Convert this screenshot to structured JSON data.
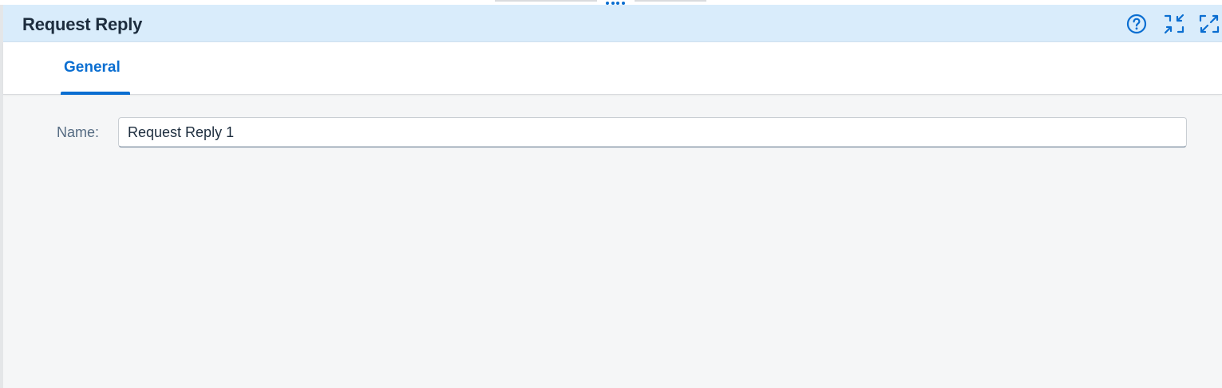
{
  "header": {
    "title": "Request Reply",
    "actions": [
      {
        "name": "help-icon"
      },
      {
        "name": "exit-fullscreen-icon"
      },
      {
        "name": "enter-fullscreen-icon"
      }
    ]
  },
  "tabs": [
    {
      "label": "General",
      "selected": true
    }
  ],
  "form": {
    "name_label": "Name:",
    "name_value": "Request Reply 1"
  },
  "colors": {
    "accent": "#0a6ed1",
    "header_bg": "#d9ecfb",
    "title_text": "#1d2d3e",
    "label_text": "#556b82",
    "page_bg": "#f5f6f7"
  }
}
